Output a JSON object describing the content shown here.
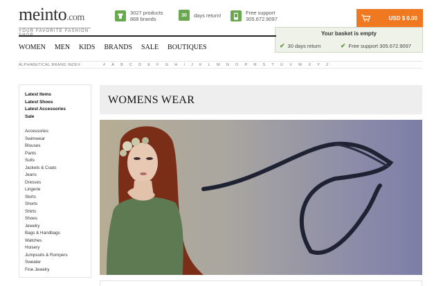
{
  "logo": {
    "main": "meinto",
    "suffix": ".com",
    "tagline": "YOUR FAVORITE FASHION SHOP"
  },
  "header_info": [
    {
      "icon": "shirt-icon",
      "badge": "",
      "lines": [
        "3027 products",
        "868 brands"
      ]
    },
    {
      "icon": "calendar-icon",
      "badge": "30",
      "lines": [
        "days return!"
      ]
    },
    {
      "icon": "phone-icon",
      "badge": "",
      "lines": [
        "Free support",
        "305.672.9097"
      ]
    }
  ],
  "basket": {
    "amount": "USD $ 0.00",
    "popup_title": "Your basket is empty",
    "features": [
      "30 days return",
      "Free support 305.672.9097"
    ],
    "accent": "#f07820"
  },
  "main_nav": [
    "WOMEN",
    "MEN",
    "KIDS",
    "BRANDS",
    "SALE",
    "BOUTIQUES"
  ],
  "brand_index": {
    "label": "ALPHABETICAL BRAND INDEX",
    "letters": [
      "#",
      "A",
      "B",
      "C",
      "D",
      "E",
      "F",
      "G",
      "H",
      "I",
      "J",
      "K",
      "L",
      "M",
      "N",
      "O",
      "P",
      "R",
      "S",
      "T",
      "U",
      "V",
      "W",
      "X",
      "Y",
      "Z"
    ]
  },
  "sidebar": {
    "featured": [
      "Latest Items",
      "Latest Shoes",
      "Latest Accessories",
      "Sale"
    ],
    "categories": [
      "Accessories",
      "Swimwear",
      "Blouses",
      "Pants",
      "Suits",
      "Jackets & Coats",
      "Jeans",
      "Dresses",
      "Lingerie",
      "Skirts",
      "Shorts",
      "Shirts",
      "Shoes",
      "Jewelry",
      "Bags & Handbags",
      "Watches",
      "Hoisery",
      "Jumpsuits & Rompers",
      "Sweater",
      "Fine Jewelry"
    ]
  },
  "page_title": "WOMENS WEAR",
  "colors": {
    "green": "#6aa84f",
    "orange": "#f07820"
  }
}
